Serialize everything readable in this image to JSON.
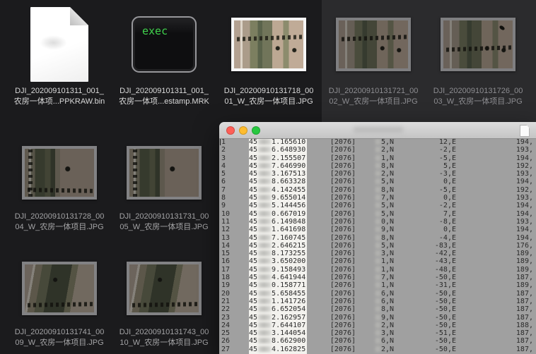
{
  "desktop": {
    "left_bg": "#1b1b1d",
    "right_bg": "#2b2b2d",
    "exec_text_color": "#3fd24c"
  },
  "files": [
    {
      "id": "ppkraw-bin",
      "kind": "document",
      "name_lines": [
        "DJI_202009101311_001_",
        "农房一体项...PPKRAW.bin"
      ],
      "emphasis": "normal",
      "cell": {
        "row": 1,
        "col": 1
      }
    },
    {
      "id": "timestamp-mrk",
      "kind": "exec",
      "icon_text": "exec",
      "name_lines": [
        "DJI_202009101311_001_",
        "农房一体项...estamp.MRK"
      ],
      "emphasis": "normal",
      "cell": {
        "row": 1,
        "col": 2
      }
    },
    {
      "id": "jpg-0001",
      "kind": "image",
      "variant": "v1",
      "features": [],
      "name_lines": [
        "DJI_20200910131718_00",
        "01_W_农房一体项目.JPG"
      ],
      "emphasis": "normal",
      "cell": {
        "row": 1,
        "col": 3
      }
    },
    {
      "id": "jpg-0002",
      "kind": "image",
      "variant": "v1",
      "features": [],
      "name_lines": [
        "DJI_20200910131721_00",
        "02_W_农房一体项目.JPG"
      ],
      "emphasis": "faint",
      "cell": {
        "row": 1,
        "col": 4
      }
    },
    {
      "id": "jpg-0003",
      "kind": "image",
      "variant": "v1",
      "features": [
        "tl-low",
        "speck-tr"
      ],
      "name_lines": [
        "DJI_20200910131726_00",
        "03_W_农房一体项目.JPG"
      ],
      "emphasis": "faint",
      "cell": {
        "row": 1,
        "col": 5
      }
    },
    {
      "id": "jpg-0004",
      "kind": "image",
      "variant": "v2",
      "features": [
        "tl-bottom"
      ],
      "name_lines": [
        "DJI_20200910131728_00",
        "04_W_农房一体项目.JPG"
      ],
      "emphasis": "dim",
      "cell": {
        "row": 2,
        "col": 1
      }
    },
    {
      "id": "jpg-0005",
      "kind": "image",
      "variant": "v2",
      "features": [],
      "name_lines": [
        "DJI_20200910131731_00",
        "05_W_农房一体项目.JPG"
      ],
      "emphasis": "dim",
      "cell": {
        "row": 2,
        "col": 2
      }
    },
    {
      "id": "jpg-0009",
      "kind": "image",
      "variant": "v3",
      "features": [],
      "name_lines": [
        "DJI_20200910131741_00",
        "09_W_农房一体项目.JPG"
      ],
      "emphasis": "dim",
      "cell": {
        "row": 3,
        "col": 1
      }
    },
    {
      "id": "jpg-0010",
      "kind": "image",
      "variant": "v3",
      "features": [],
      "name_lines": [
        "DJI_20200910131743_00",
        "10_W_农房一体项目.JPG"
      ],
      "emphasis": "dim",
      "cell": {
        "row": 3,
        "col": 2
      }
    }
  ],
  "window": {
    "title": "",
    "traffic_lights": {
      "close": "#ff5f57",
      "minimize": "#febc2e",
      "zoom": "#28c840"
    },
    "content_bg": "#a0a0a0",
    "strip_bg": "#f3f2ee",
    "text_color": "#2a2a2a",
    "time_prefix": "45",
    "bracket": "[2076]",
    "rows": [
      {
        "line": "1",
        "time": "1.165610",
        "north": "5,N",
        "east": "12,E",
        "alt": "194,"
      },
      {
        "line": "2",
        "time": "6.648930",
        "north": "2,N",
        "east": "-2,E",
        "alt": "193,"
      },
      {
        "line": "3",
        "time": "2.155507",
        "north": "1,N",
        "east": "-5,E",
        "alt": "194,"
      },
      {
        "line": "4",
        "time": "7.646990",
        "north": "8,N",
        "east": "5,E",
        "alt": "192,"
      },
      {
        "line": "5",
        "time": "3.167513",
        "north": "2,N",
        "east": "-3,E",
        "alt": "193,"
      },
      {
        "line": "6",
        "time": "8.663328",
        "north": "5,N",
        "east": "0,E",
        "alt": "194,"
      },
      {
        "line": "7",
        "time": "4.142455",
        "north": "8,N",
        "east": "-5,E",
        "alt": "192,"
      },
      {
        "line": "8",
        "time": "9.655014",
        "north": "7,N",
        "east": "0,E",
        "alt": "193,"
      },
      {
        "line": "9",
        "time": "5.144456",
        "north": "5,N",
        "east": "-2,E",
        "alt": "194,"
      },
      {
        "line": "10",
        "time": "0.667019",
        "north": "5,N",
        "east": "7,E",
        "alt": "194,"
      },
      {
        "line": "11",
        "time": "6.149848",
        "north": "0,N",
        "east": "-8,E",
        "alt": "193,"
      },
      {
        "line": "12",
        "time": "1.641698",
        "north": "9,N",
        "east": "0,E",
        "alt": "194,"
      },
      {
        "line": "13",
        "time": "7.160745",
        "north": "8,N",
        "east": "-4,E",
        "alt": "194,"
      },
      {
        "line": "14",
        "time": "2.646215",
        "north": "5,N",
        "east": "-83,E",
        "alt": "176,"
      },
      {
        "line": "15",
        "time": "8.173255",
        "north": "3,N",
        "east": "-42,E",
        "alt": "189,"
      },
      {
        "line": "16",
        "time": "3.650200",
        "north": "1,N",
        "east": "-43,E",
        "alt": "189,"
      },
      {
        "line": "17",
        "time": "9.158493",
        "north": "1,N",
        "east": "-48,E",
        "alt": "189,"
      },
      {
        "line": "18",
        "time": "4.641944",
        "north": "7,N",
        "east": "-50,E",
        "alt": "187,"
      },
      {
        "line": "19",
        "time": "0.158771",
        "north": "1,N",
        "east": "-31,E",
        "alt": "189,"
      },
      {
        "line": "20",
        "time": "5.658455",
        "north": "6,N",
        "east": "-50,E",
        "alt": "187,"
      },
      {
        "line": "21",
        "time": "1.141726",
        "north": "6,N",
        "east": "-50,E",
        "alt": "187,"
      },
      {
        "line": "22",
        "time": "6.652054",
        "north": "8,N",
        "east": "-50,E",
        "alt": "187,"
      },
      {
        "line": "23",
        "time": "2.162957",
        "north": "9,N",
        "east": "-50,E",
        "alt": "187,"
      },
      {
        "line": "24",
        "time": "7.644107",
        "north": "2,N",
        "east": "-50,E",
        "alt": "188,"
      },
      {
        "line": "25",
        "time": "3.144054",
        "north": "3,N",
        "east": "-51,E",
        "alt": "187,"
      },
      {
        "line": "26",
        "time": "8.662900",
        "north": "6,N",
        "east": "-50,E",
        "alt": "187,"
      },
      {
        "line": "27",
        "time": "4.162825",
        "north": "2,N",
        "east": "-50,E",
        "alt": "187,"
      }
    ]
  }
}
